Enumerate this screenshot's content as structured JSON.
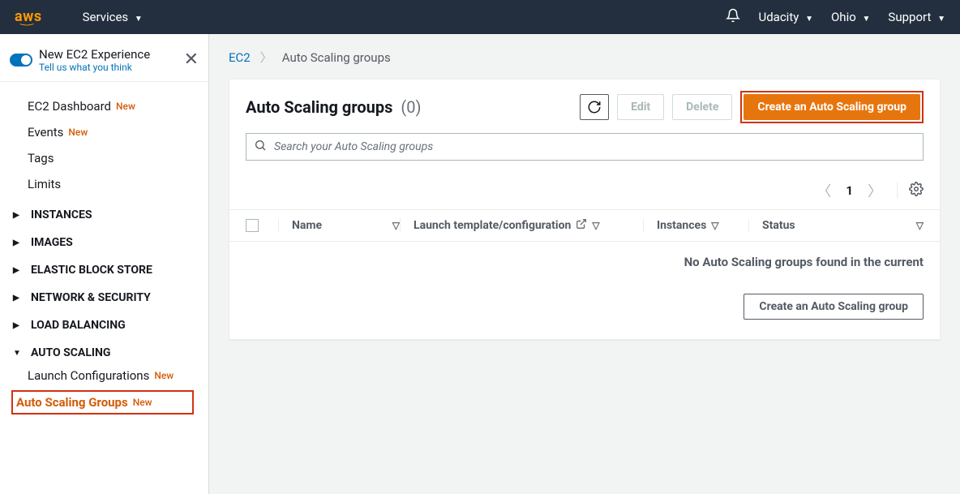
{
  "topnav": {
    "logo": "aws",
    "services": "Services",
    "account": "Udacity",
    "region": "Ohio",
    "support": "Support"
  },
  "sidebar": {
    "experience": {
      "title": "New EC2 Experience",
      "link": "Tell us what you think"
    },
    "top_items": [
      {
        "label": "EC2 Dashboard",
        "new": "New"
      },
      {
        "label": "Events",
        "new": "New"
      },
      {
        "label": "Tags",
        "new": ""
      },
      {
        "label": "Limits",
        "new": ""
      }
    ],
    "sections": [
      {
        "label": "INSTANCES",
        "expanded": false
      },
      {
        "label": "IMAGES",
        "expanded": false
      },
      {
        "label": "ELASTIC BLOCK STORE",
        "expanded": false
      },
      {
        "label": "NETWORK & SECURITY",
        "expanded": false
      },
      {
        "label": "LOAD BALANCING",
        "expanded": false
      },
      {
        "label": "AUTO SCALING",
        "expanded": true,
        "children": [
          {
            "label": "Launch Configurations",
            "new": "New"
          },
          {
            "label": "Auto Scaling Groups",
            "new": "New",
            "selected": true
          }
        ]
      }
    ]
  },
  "breadcrumb": {
    "root": "EC2",
    "current": "Auto Scaling groups"
  },
  "panel": {
    "title": "Auto Scaling groups",
    "count": "(0)",
    "edit": "Edit",
    "delete": "Delete",
    "create": "Create an Auto Scaling group",
    "search_placeholder": "Search your Auto Scaling groups",
    "page": "1",
    "columns": {
      "name": "Name",
      "launch": "Launch template/configuration",
      "instances": "Instances",
      "status": "Status"
    },
    "empty_msg": "No Auto Scaling groups found in the current",
    "empty_btn": "Create an Auto Scaling group"
  }
}
